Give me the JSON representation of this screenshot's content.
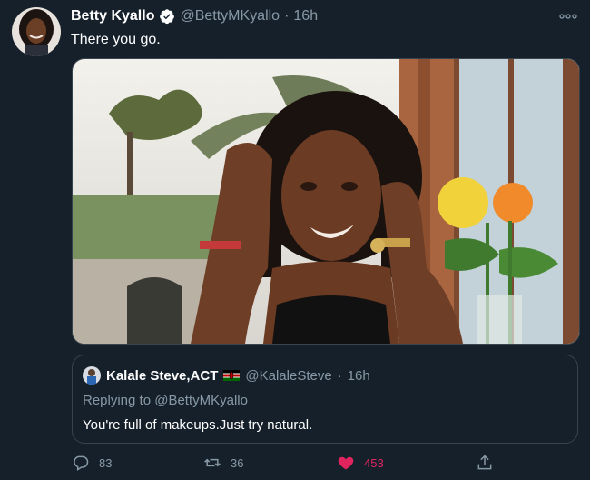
{
  "tweet": {
    "author_name": "Betty Kyallo",
    "author_handle": "@BettyMKyallo",
    "separator": "·",
    "time": "16h",
    "text": "There you go.",
    "more_icon": "more-icon",
    "verified_color": "#ffffff"
  },
  "quote": {
    "author_name": "Kalale Steve,ACT",
    "author_handle": "@KalaleSteve",
    "separator": "·",
    "time": "16h",
    "replying_to": "Replying to @BettyMKyallo",
    "text": "You're full of makeups.Just try natural.",
    "flag_icon": "kenya-flag-icon"
  },
  "actions": {
    "reply_count": "83",
    "retweet_count": "36",
    "like_count": "453",
    "like_color": "#e0245e"
  },
  "colors": {
    "background": "#15202b",
    "secondary_text": "#8899a6",
    "border": "#38444d"
  }
}
